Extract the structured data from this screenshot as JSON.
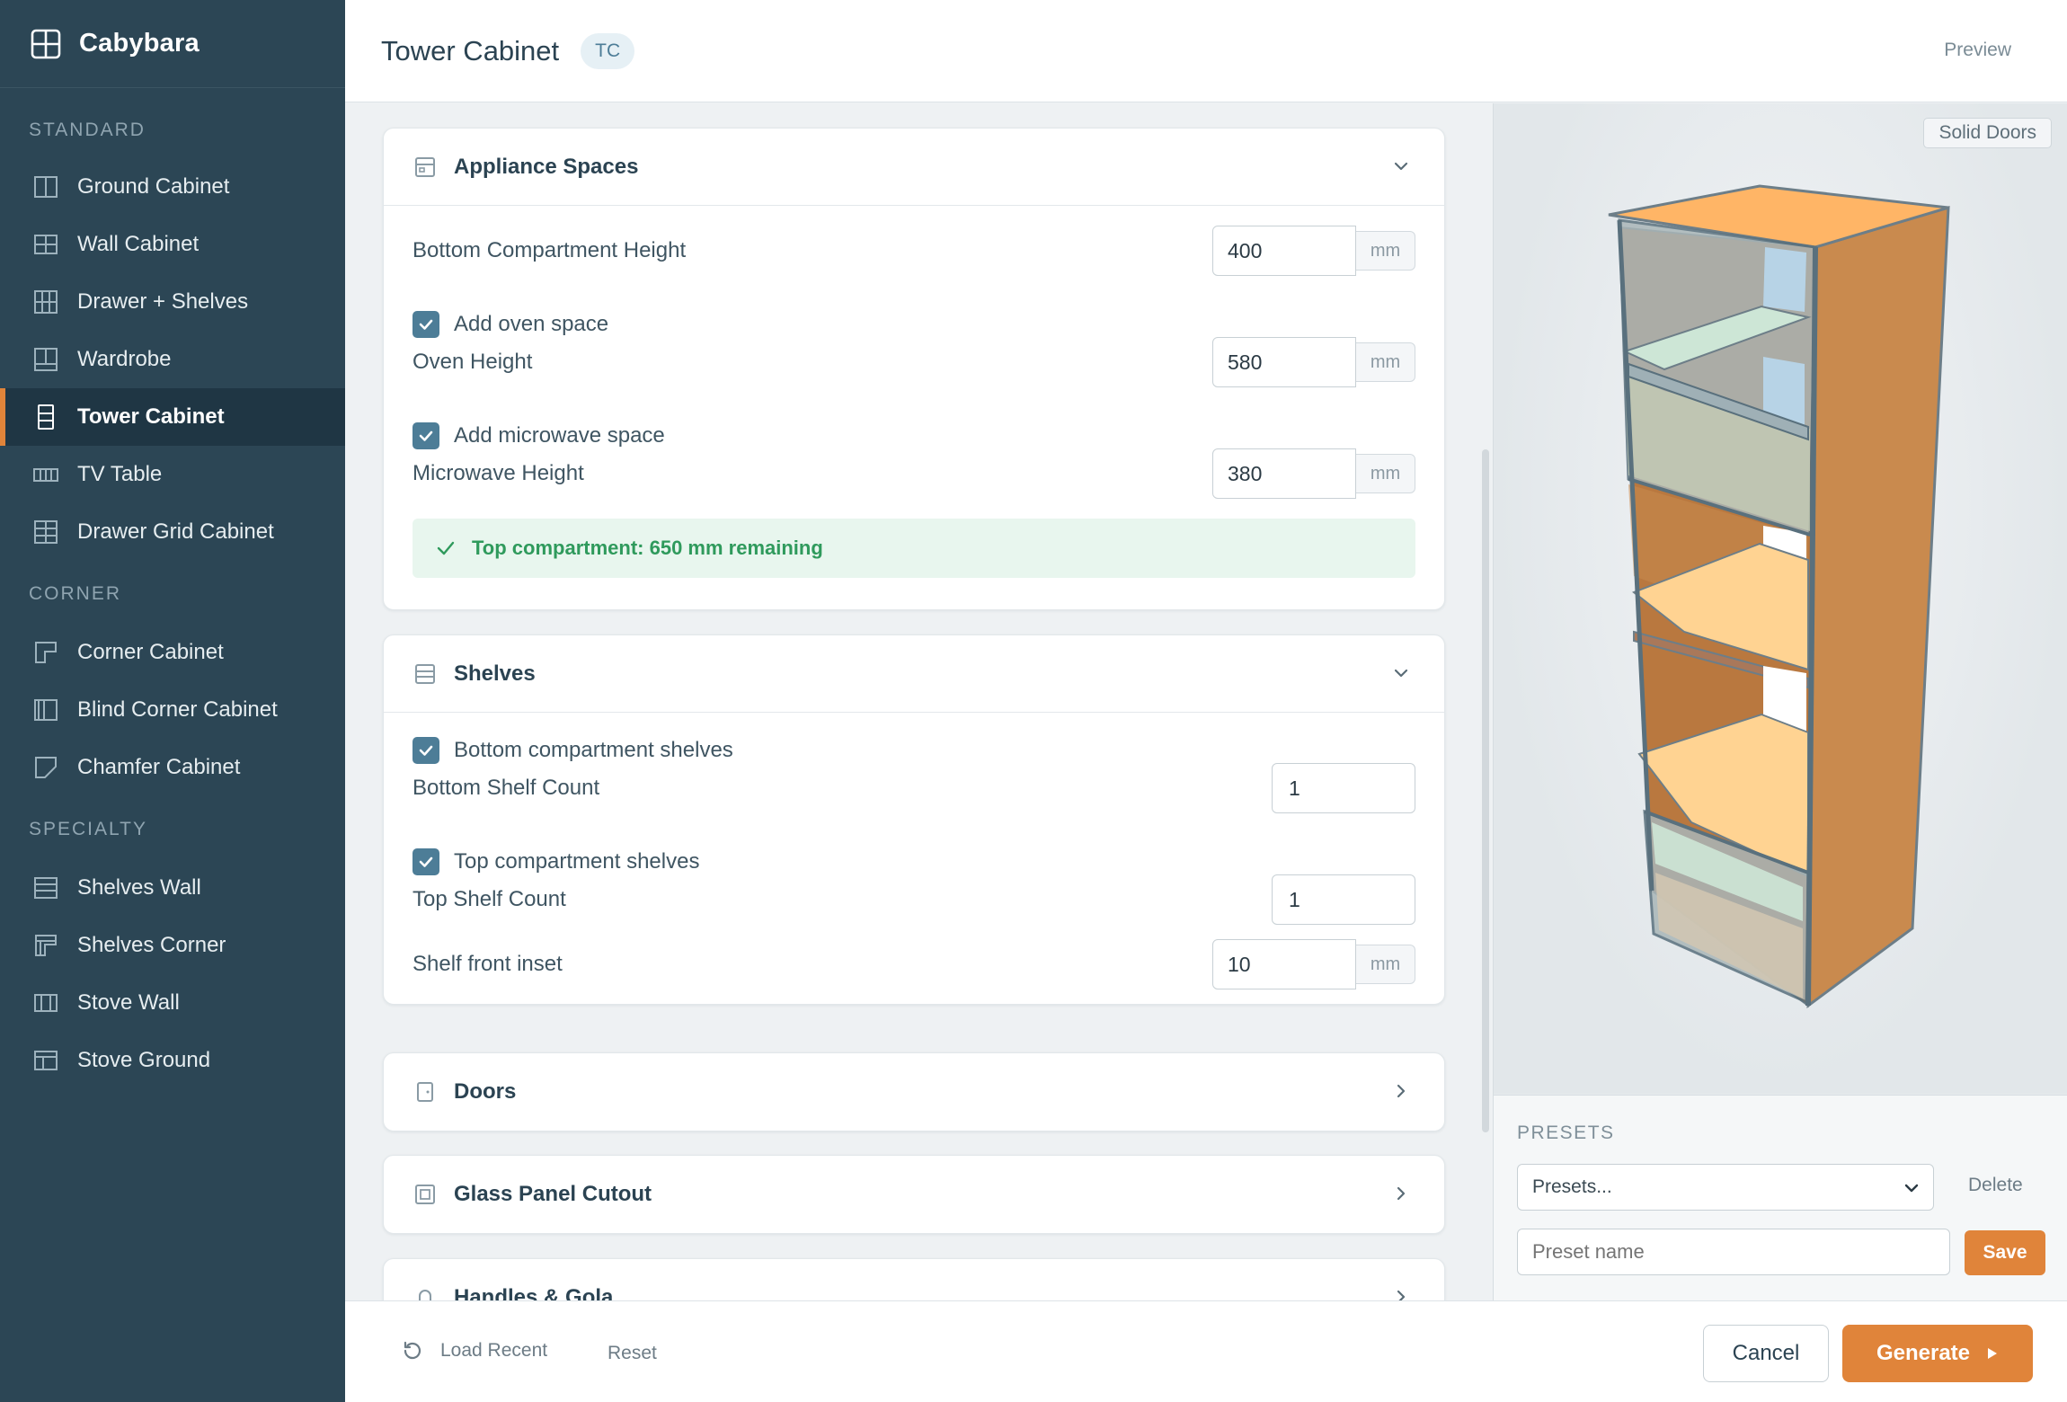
{
  "app": {
    "name": "Cabybara"
  },
  "sidebar": {
    "sections": [
      {
        "label": "STANDARD",
        "items": [
          {
            "label": "Ground Cabinet",
            "icon": "ground-cabinet-icon"
          },
          {
            "label": "Wall Cabinet",
            "icon": "wall-cabinet-icon"
          },
          {
            "label": "Drawer + Shelves",
            "icon": "drawer-shelves-icon"
          },
          {
            "label": "Wardrobe",
            "icon": "wardrobe-icon"
          },
          {
            "label": "Tower Cabinet",
            "icon": "tower-cabinet-icon",
            "active": true
          },
          {
            "label": "TV Table",
            "icon": "tv-table-icon"
          },
          {
            "label": "Drawer Grid Cabinet",
            "icon": "drawer-grid-icon"
          }
        ]
      },
      {
        "label": "CORNER",
        "items": [
          {
            "label": "Corner Cabinet",
            "icon": "corner-cabinet-icon"
          },
          {
            "label": "Blind Corner Cabinet",
            "icon": "blind-corner-icon"
          },
          {
            "label": "Chamfer Cabinet",
            "icon": "chamfer-cabinet-icon"
          }
        ]
      },
      {
        "label": "SPECIALTY",
        "items": [
          {
            "label": "Shelves Wall",
            "icon": "shelves-wall-icon"
          },
          {
            "label": "Shelves Corner",
            "icon": "shelves-corner-icon"
          },
          {
            "label": "Stove Wall",
            "icon": "stove-wall-icon"
          },
          {
            "label": "Stove Ground",
            "icon": "stove-ground-icon"
          }
        ]
      }
    ]
  },
  "header": {
    "title": "Tower Cabinet",
    "badge": "TC",
    "preview_label": "Preview"
  },
  "appliance": {
    "title": "Appliance Spaces",
    "bottom_height_label": "Bottom Compartment Height",
    "bottom_height_value": "400",
    "oven_check_label": "Add oven space",
    "oven_height_label": "Oven Height",
    "oven_height_value": "580",
    "microwave_check_label": "Add microwave space",
    "microwave_height_label": "Microwave Height",
    "microwave_height_value": "380",
    "unit": "mm",
    "status": "Top compartment: 650 mm remaining"
  },
  "shelves": {
    "title": "Shelves",
    "bottom_check_label": "Bottom compartment shelves",
    "bottom_count_label": "Bottom Shelf Count",
    "bottom_count_value": "1",
    "top_check_label": "Top compartment shelves",
    "top_count_label": "Top Shelf Count",
    "top_count_value": "1",
    "inset_label": "Shelf front inset",
    "inset_value": "10",
    "unit": "mm"
  },
  "collapsed_sections": {
    "doors": "Doors",
    "glass": "Glass Panel Cutout",
    "handles": "Handles & Gola"
  },
  "preview_panel": {
    "mode_label": "Solid Doors",
    "presets_label": "PRESETS",
    "presets_select": "Presets...",
    "delete_label": "Delete",
    "preset_name_placeholder": "Preset name",
    "save_label": "Save"
  },
  "footer": {
    "load_recent": "Load Recent",
    "reset": "Reset",
    "cancel": "Cancel",
    "generate": "Generate"
  },
  "colors": {
    "sidebar": "#2c4655",
    "accent": "#e0843a",
    "primary": "#4d7d97",
    "success": "#2f9a5c"
  }
}
